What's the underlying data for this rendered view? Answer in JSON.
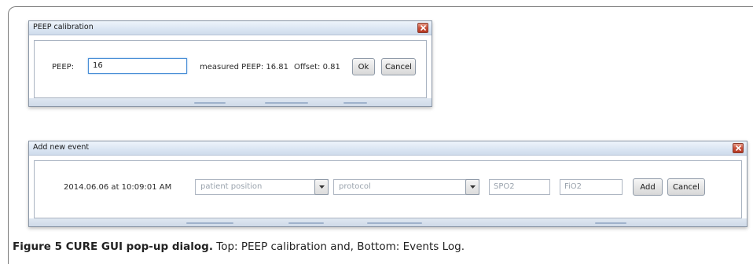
{
  "peep_dialog": {
    "title": "PEEP calibration",
    "peep_label": "PEEP:",
    "peep_value": "16",
    "measured_text": "measured PEEP: 16.81",
    "offset_text": "Offset: 0.81",
    "ok_label": "Ok",
    "cancel_label": "Cancel"
  },
  "event_dialog": {
    "title": "Add new event",
    "timestamp": "2014.06.06 at 10:09:01 AM",
    "patient_position_placeholder": "patient position",
    "protocol_placeholder": "protocol",
    "spo2_placeholder": "SPO2",
    "fio2_placeholder": "FiO2",
    "add_label": "Add",
    "cancel_label": "Cancel"
  },
  "caption": {
    "bold": "Figure 5 CURE GUI pop-up dialog.",
    "text": " Top: PEEP calibration and, Bottom: Events Log."
  },
  "colors": {
    "titlebar": "#dbe6f3",
    "close_button": "#c9503a",
    "focus_border": "#4a8fd6"
  }
}
